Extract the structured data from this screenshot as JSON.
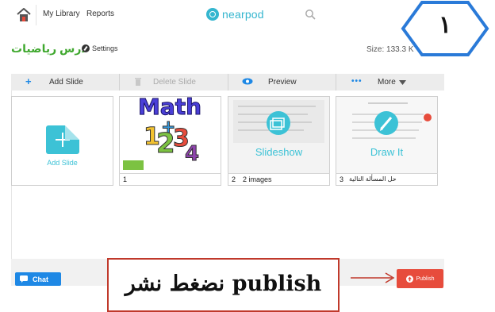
{
  "nav": {
    "my_library": "My Library",
    "reports": "Reports",
    "logo_text": "nearpod"
  },
  "annotation": {
    "hex_number": "١",
    "instruction": "نضغط نشر publish"
  },
  "lesson": {
    "title": "درس رياضيات",
    "settings_label": "Settings",
    "size_label": "Size: 133.3 K"
  },
  "toolbar": {
    "add_slide": "Add Slide",
    "delete_slide": "Delete Slide",
    "preview": "Preview",
    "more": "More"
  },
  "slides": [
    {
      "label": "Add Slide"
    },
    {
      "number": "1",
      "caption": "",
      "image_text": "Math"
    },
    {
      "number": "2",
      "caption": "2 images",
      "type_label": "Slideshow"
    },
    {
      "number": "3",
      "caption": "حل المسألة التالية",
      "type_label": "Draw It"
    }
  ],
  "bottom": {
    "chat_label": "Chat",
    "publish_label": "Publish"
  },
  "colors": {
    "brand": "#35b6cf",
    "title_green": "#3fa82e",
    "hex_border": "#2a7ad8",
    "publish": "#e74c3c",
    "chat": "#1e88e5",
    "annotation_border": "#c0392b"
  },
  "icons": [
    "home-icon",
    "search-icon",
    "settings-icon",
    "plus-icon",
    "trash-icon",
    "eye-icon",
    "dots-icon",
    "caret-down-icon",
    "chat-icon",
    "publish-icon",
    "slideshow-icon",
    "pencil-icon"
  ]
}
